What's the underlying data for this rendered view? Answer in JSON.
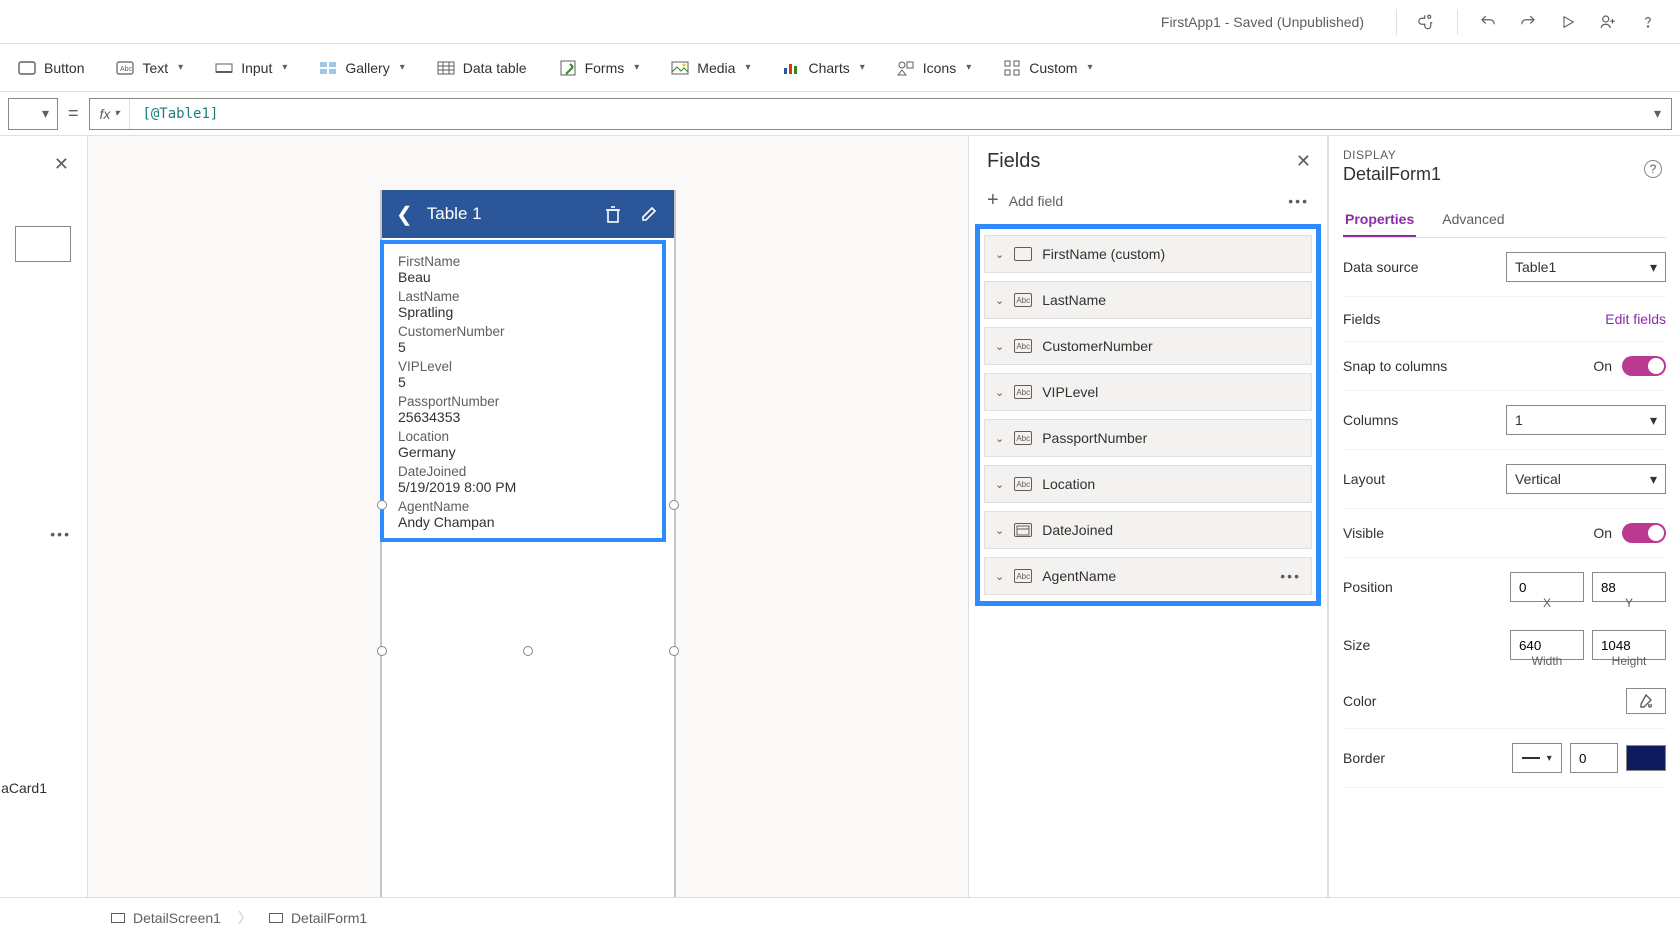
{
  "titlebar": {
    "title": "FirstApp1 - Saved (Unpublished)"
  },
  "ribbon": {
    "button": "Button",
    "text": "Text",
    "input": "Input",
    "gallery": "Gallery",
    "datatable": "Data table",
    "forms": "Forms",
    "media": "Media",
    "charts": "Charts",
    "icons": "Icons",
    "custom": "Custom"
  },
  "formula": {
    "value": "[@Table1]",
    "fx": "fx"
  },
  "leftpanel": {
    "acard": "aCard1"
  },
  "phone": {
    "appbar_title": "Table 1",
    "cards": [
      {
        "label": "FirstName",
        "value": "Beau"
      },
      {
        "label": "LastName",
        "value": "Spratling"
      },
      {
        "label": "CustomerNumber",
        "value": "5"
      },
      {
        "label": "VIPLevel",
        "value": "5"
      },
      {
        "label": "PassportNumber",
        "value": "25634353"
      },
      {
        "label": "Location",
        "value": "Germany"
      },
      {
        "label": "DateJoined",
        "value": "5/19/2019 8:00 PM"
      },
      {
        "label": "AgentName",
        "value": "Andy Champan"
      }
    ]
  },
  "fieldspanel": {
    "title": "Fields",
    "addfield": "Add field",
    "items": [
      {
        "name": "FirstName (custom)",
        "icon": "card"
      },
      {
        "name": "LastName",
        "icon": "abc"
      },
      {
        "name": "CustomerNumber",
        "icon": "abc"
      },
      {
        "name": "VIPLevel",
        "icon": "abc"
      },
      {
        "name": "PassportNumber",
        "icon": "abc"
      },
      {
        "name": "Location",
        "icon": "abc"
      },
      {
        "name": "DateJoined",
        "icon": "cal"
      },
      {
        "name": "AgentName",
        "icon": "abc",
        "more": true
      }
    ]
  },
  "properties": {
    "section": "DISPLAY",
    "name": "DetailForm1",
    "tabs": {
      "properties": "Properties",
      "advanced": "Advanced"
    },
    "datasource_label": "Data source",
    "datasource_value": "Table1",
    "fields_label": "Fields",
    "editfields": "Edit fields",
    "snap_label": "Snap to columns",
    "snap_value": "On",
    "columns_label": "Columns",
    "columns_value": "1",
    "layout_label": "Layout",
    "layout_value": "Vertical",
    "visible_label": "Visible",
    "visible_value": "On",
    "position_label": "Position",
    "pos_x": "0",
    "pos_y": "88",
    "pos_xlabel": "X",
    "pos_ylabel": "Y",
    "size_label": "Size",
    "size_w": "640",
    "size_h": "1048",
    "size_wlabel": "Width",
    "size_hlabel": "Height",
    "color_label": "Color",
    "border_label": "Border",
    "border_width": "0"
  },
  "breadcrumb": {
    "screen": "DetailScreen1",
    "form": "DetailForm1"
  }
}
